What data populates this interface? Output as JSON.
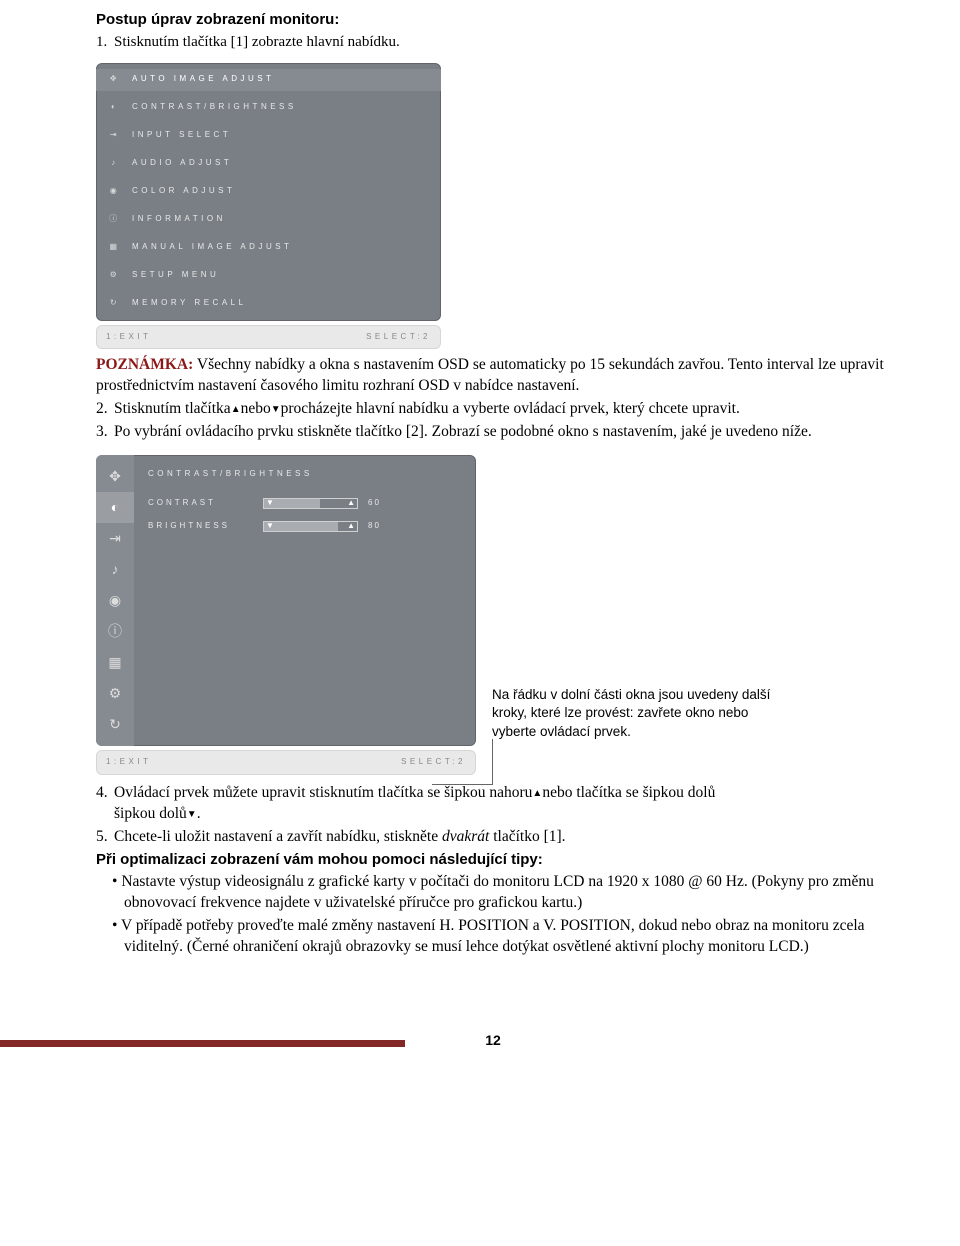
{
  "title": "Postup úprav zobrazení monitoru:",
  "step1": "Stisknutím tlačítka [1] zobrazte hlavní nabídku.",
  "osd1": {
    "items": [
      "AUTO IMAGE ADJUST",
      "CONTRAST/BRIGHTNESS",
      "INPUT SELECT",
      "AUDIO ADJUST",
      "COLOR ADJUST",
      "INFORMATION",
      "MANUAL IMAGE ADJUST",
      "SETUP MENU",
      "MEMORY RECALL"
    ],
    "footer_left": "1:EXIT",
    "footer_right": "SELECT:2"
  },
  "note_label": "POZNÁMKA:",
  "note_text": " Všechny nabídky a okna s nastavením OSD se automaticky po 15 sekundách zavřou. Tento interval lze upravit prostřednictvím nastavení časového limitu rozhraní OSD v nabídce nastavení.",
  "step2_a": "Stisknutím tlačítka",
  "step2_b": "nebo",
  "step2_c": "procházejte hlavní nabídku a vyberte ovládací prvek, který chcete upravit.",
  "step3": "Po vybrání ovládacího prvku stiskněte tlačítko [2]. Zobrazí se podobné okno s nastavením, jaké je uvedeno níže.",
  "osd2": {
    "title": "CONTRAST/BRIGHTNESS",
    "rows": [
      {
        "label": "CONTRAST",
        "value": "60",
        "pct": 60
      },
      {
        "label": "BRIGHTNESS",
        "value": "80",
        "pct": 80
      }
    ],
    "footer_left": "1:EXIT",
    "footer_right": "SELECT:2"
  },
  "callout": "Na řádku v dolní části okna jsou uvedeny další kroky, které lze provést: zavřete okno nebo vyberte ovládací prvek.",
  "step4_a": "Ovládací prvek můžete upravit stisknutím tlačítka se šipkou nahoru",
  "step4_b": "nebo tlačítka se šipkou dolů",
  "step4_c": ".",
  "step5_a": "Chcete-li uložit nastavení a zavřít nabídku, stiskněte ",
  "step5_b": "dvakrát",
  "step5_c": " tlačítko [1].",
  "tips_heading": "Při optimalizaci zobrazení vám mohou pomoci následující tipy:",
  "tip1": "Nastavte výstup videosignálu z grafické karty v počítači do monitoru LCD na 1920 x 1080 @ 60 Hz. (Pokyny pro změnu obnovovací frekvence najdete v uživatelské příručce pro grafickou kartu.)",
  "tip2": "V případě potřeby proveďte malé změny nastavení H. POSITION a V. POSITION, dokud nebo obraz na monitoru zcela viditelný. (Černé ohraničení okrajů obrazovky se musí lehce dotýkat osvětlené aktivní plochy monitoru LCD.)",
  "page_num": "12"
}
